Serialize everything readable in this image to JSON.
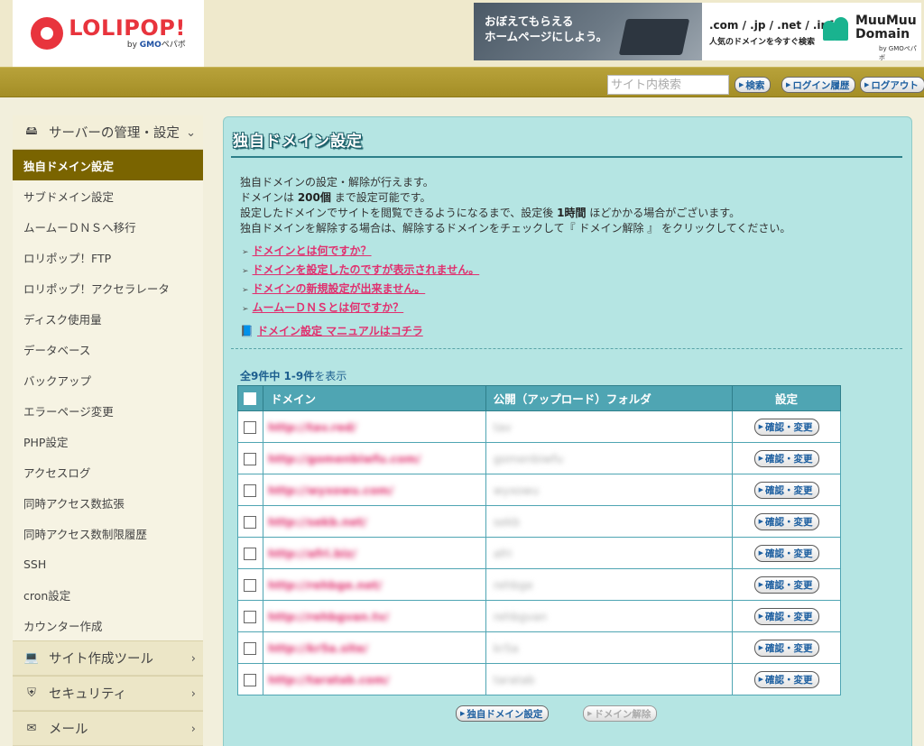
{
  "header": {
    "logo": {
      "main": "LOLIPOP!",
      "sub_prefix": "by",
      "sub_brand": "GMO",
      "sub_suffix": "ペパボ"
    },
    "banner": {
      "left_line1": "おぼえてもらえる",
      "left_line2": "ホームページにしよう。",
      "domains": ".com / .jp / .net / .info",
      "tagline": "人気のドメインを今すぐ検索",
      "brand_line1": "MuuMuu",
      "brand_line2": "Domain",
      "brand_sub": "by GMOペパボ"
    }
  },
  "topbar": {
    "search_placeholder": "サイト内検索",
    "search_label": "検索",
    "history_label": "ログイン履歴",
    "logout_label": "ログアウト"
  },
  "sidebar": {
    "section_title": "サーバーの管理・設定",
    "items": [
      "独自ドメイン設定",
      "サブドメイン設定",
      "ムームーＤＮＳへ移行",
      "ロリポップ！FTP",
      "ロリポップ！アクセラレータ",
      "ディスク使用量",
      "データベース",
      "バックアップ",
      "エラーページ変更",
      "PHP設定",
      "アクセスログ",
      "同時アクセス数拡張",
      "同時アクセス数制限履歴",
      "SSH",
      "cron設定",
      "カウンター作成"
    ],
    "lower_sections": [
      "サイト作成ツール",
      "セキュリティ",
      "メール"
    ]
  },
  "main": {
    "title": "独自ドメイン設定",
    "desc1": "独自ドメインの設定・解除が行えます。",
    "desc2_a": "ドメインは ",
    "desc2_b": "200個",
    "desc2_c": " まで設定可能です。",
    "desc3_a": "設定したドメインでサイトを閲覧できるようになるまで、設定後 ",
    "desc3_b": "1時間",
    "desc3_c": " ほどかかる場合がございます。",
    "desc4": "独自ドメインを解除する場合は、解除するドメインをチェックして『 ドメイン解除 』 をクリックしてください。",
    "faq": [
      "ドメインとは何ですか？",
      "ドメインを設定したのですが表示されません。",
      "ドメインの新規設定が出来ません。",
      "ムームーＤＮＳとは何ですか？"
    ],
    "manual": "ドメイン設定 マニュアルはコチラ",
    "count_a": "全9件中 ",
    "count_b": "1-9件",
    "count_c": "を表示",
    "table": {
      "headers": [
        "ドメイン",
        "公開（アップロード）フォルダ",
        "設定"
      ],
      "button_label": "確認・変更",
      "rows": [
        {
          "domain": "http://tav.red/",
          "folder": "tav"
        },
        {
          "domain": "http://gomenbiwfu.com/",
          "folder": "gomenbiwfu"
        },
        {
          "domain": "http://wyxowu.com/",
          "folder": "wyxowu"
        },
        {
          "domain": "http://sekb.net/",
          "folder": "sekb"
        },
        {
          "domain": "http://afri.biz/",
          "folder": "afri"
        },
        {
          "domain": "http://rehbge.net/",
          "folder": "rehbge"
        },
        {
          "domain": "http://rehbgvan.tv/",
          "folder": "rehbgvan"
        },
        {
          "domain": "http://kr5a.site/",
          "folder": "kr5a"
        },
        {
          "domain": "http://taratab.com/",
          "folder": "taratab"
        }
      ]
    },
    "btn_set": "独自ドメイン設定",
    "btn_release": "ドメイン解除"
  }
}
